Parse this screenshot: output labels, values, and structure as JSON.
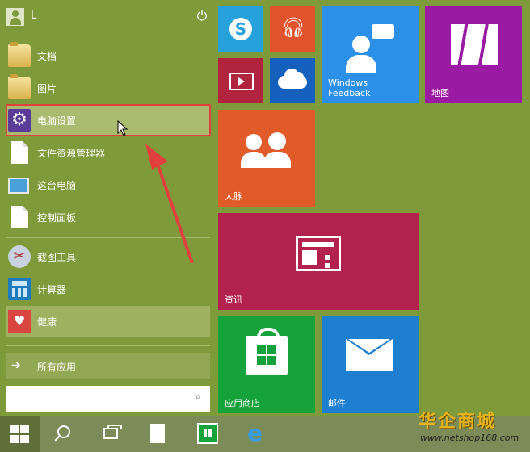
{
  "colors": {
    "desktop": "#7f9a3a",
    "selection_outline": "#e2403c",
    "annotation_arrow": "#e2403c",
    "tile_skype": "#27a1dc",
    "tile_music": "#e0532c",
    "tile_video": "#b0243d",
    "tile_onedrive": "#1560bd",
    "tile_feedback": "#2c90e8",
    "tile_maps": "#9b1aa3",
    "tile_people": "#e15a2a",
    "tile_news": "#b3224f",
    "tile_store": "#15a23a",
    "tile_mail": "#1e7fd1"
  },
  "user": {
    "name": "L"
  },
  "menu": {
    "items": [
      {
        "label": "文档",
        "icon": "folder-icon"
      },
      {
        "label": "图片",
        "icon": "folder-icon"
      },
      {
        "label": "电脑设置",
        "icon": "gear-icon",
        "selected": true
      },
      {
        "label": "文件资源管理器",
        "icon": "document-icon"
      },
      {
        "label": "这台电脑",
        "icon": "computer-icon"
      },
      {
        "label": "控制面板",
        "icon": "document-icon"
      },
      {
        "label": "截图工具",
        "icon": "scissors-icon"
      },
      {
        "label": "计算器",
        "icon": "calculator-icon"
      },
      {
        "label": "健康",
        "icon": "heart-icon"
      }
    ],
    "all_apps": "所有应用",
    "search_placeholder": ""
  },
  "tiles": {
    "feedback": "Windows\nFeedback",
    "feedback_line1": "Windows",
    "feedback_line2": "Feedback",
    "maps": "地图",
    "people": "人脉",
    "news": "资讯",
    "store": "应用商店",
    "mail": "邮件"
  },
  "watermark": {
    "brand": "华企商城",
    "url": "www.netshop168.com"
  }
}
